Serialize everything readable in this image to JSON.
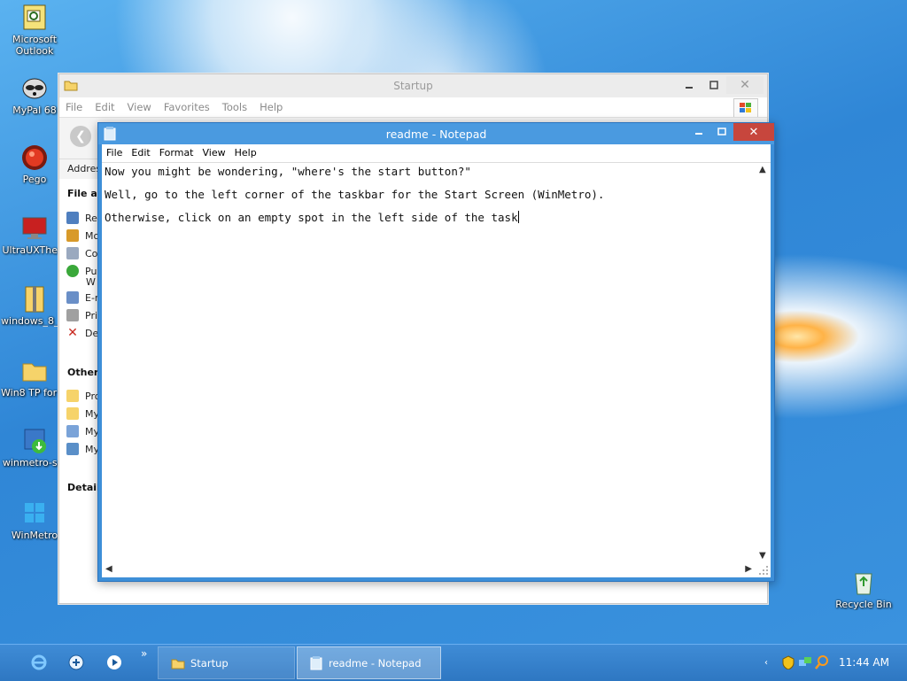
{
  "desktop": {
    "icons": [
      {
        "label": "Microsoft Outlook",
        "icon": "outlook-icon"
      },
      {
        "label": "MyPal 68",
        "icon": "mypal-icon"
      },
      {
        "label": "Pego",
        "icon": "pego-icon"
      },
      {
        "label": "UltraUXThe...",
        "icon": "ultraux-icon"
      },
      {
        "label": "windows_8_...",
        "icon": "zip-folder-icon"
      },
      {
        "label": "Win8 TP for ...",
        "icon": "folder-icon"
      },
      {
        "label": "winmetro-s...",
        "icon": "installer-icon"
      },
      {
        "label": "WinMetro",
        "icon": "winmetro-icon"
      },
      {
        "label": "Recycle Bin",
        "icon": "recycle-bin-icon"
      }
    ]
  },
  "explorer": {
    "title": "Startup",
    "menu": [
      "File",
      "Edit",
      "View",
      "Favorites",
      "Tools",
      "Help"
    ],
    "address_label": "Addres",
    "side": {
      "file_tasks_head": "File an",
      "file_tasks": [
        "Re",
        "Mo",
        "Co",
        "Pu",
        "W",
        "E-r",
        "Pri",
        "De"
      ],
      "other_head": "Other I",
      "other_items": [
        "Pro",
        "My",
        "My",
        "My"
      ],
      "details_head": "Details"
    }
  },
  "notepad": {
    "title": "readme - Notepad",
    "menu": [
      "File",
      "Edit",
      "Format",
      "View",
      "Help"
    ],
    "lines": [
      "Now you might be wondering, \"where's the start button?\"",
      "Well, go to the left corner of the taskbar for the Start Screen (WinMetro).",
      "Otherwise, click on an empty spot in the left side of the task"
    ]
  },
  "taskbar": {
    "overflow_chevron": "»",
    "tasks": [
      {
        "label": "Startup",
        "icon": "folder-icon"
      },
      {
        "label": "readme - Notepad",
        "icon": "notepad-icon"
      }
    ],
    "tray_icons": [
      "defender-shield-icon",
      "network-icon",
      "search-icon"
    ],
    "clock": "11:44 AM"
  },
  "colors": {
    "taskbar": "#2e77c2",
    "notepad_frame": "#3d8fd8",
    "close_button": "#c7463d"
  }
}
